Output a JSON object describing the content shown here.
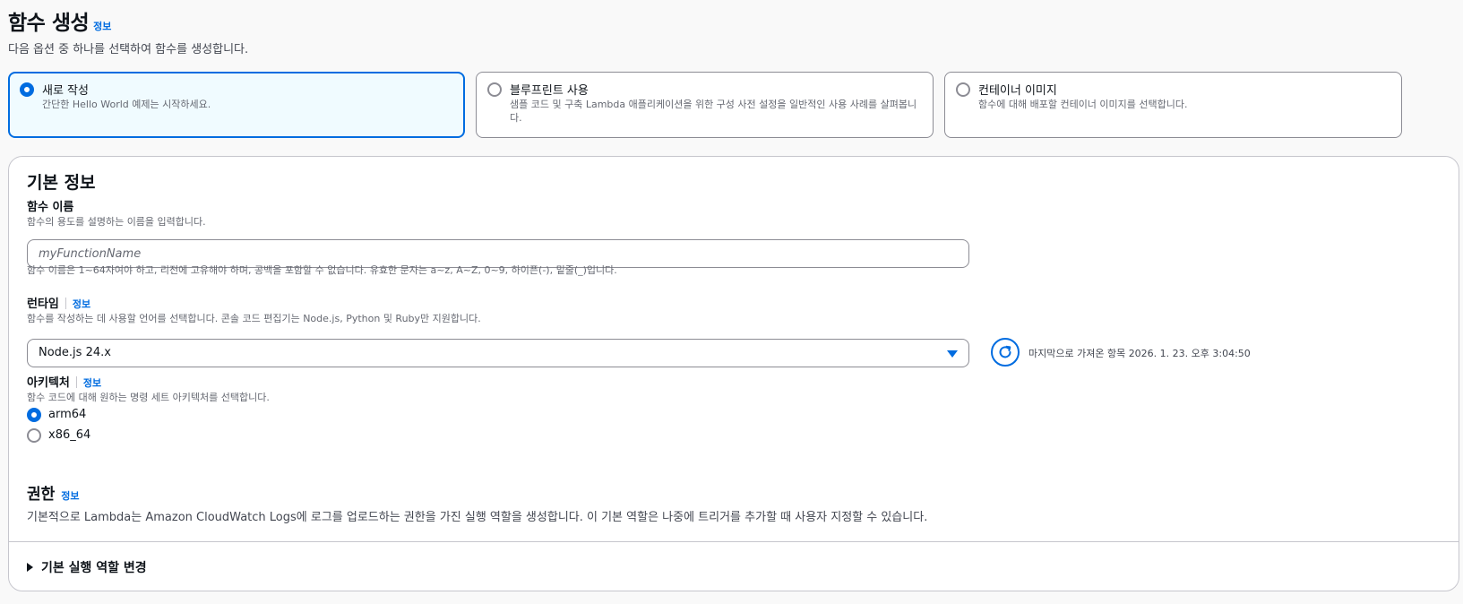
{
  "header": {
    "title": "함수 생성",
    "info": "정보",
    "description": "다음 옵션 중 하나를 선택하여 함수를 생성합니다."
  },
  "options": [
    {
      "label": "새로 작성",
      "description": "간단한 Hello World 예제는 시작하세요.",
      "selected": true
    },
    {
      "label": "블루프린트 사용",
      "description": "샘플 코드 및 구축 Lambda 애플리케이션을 위한 구성 사전 설정을 일반적인 사용 사례를 살펴봅니다.",
      "selected": false
    },
    {
      "label": "컨테이너 이미지",
      "description": "함수에 대해 배포할 컨테이너 이미지를 선택합니다.",
      "selected": false
    }
  ],
  "basic": {
    "title": "기본 정보",
    "function_name": {
      "label": "함수 이름",
      "description": "함수의 용도를 설명하는 이름을 입력합니다.",
      "placeholder": "myFunctionName",
      "value": "",
      "constraint": "함수 이름은 1~64자여야 하고, 리전에 고유해야 하며, 공백을 포함할 수 없습니다. 유효한 문자는 a~z, A~Z, 0~9, 하이픈(-), 밑줄(_)입니다."
    },
    "runtime": {
      "label": "런타임",
      "info": "정보",
      "description": "함수를 작성하는 데 사용할 언어를 선택합니다. 콘솔 코드 편집기는 Node.js, Python 및 Ruby만 지원합니다.",
      "selected": "Node.js 24.x",
      "last_fetched": "마지막으로 가져온 항목 2026. 1. 23. 오후 3:04:50"
    },
    "architecture": {
      "label": "아키텍처",
      "info": "정보",
      "description": "함수 코드에 대해 원하는 명령 세트 아키텍처를 선택합니다.",
      "options": [
        {
          "label": "arm64",
          "selected": true
        },
        {
          "label": "x86_64",
          "selected": false
        }
      ]
    },
    "permissions": {
      "title": "권한",
      "info": "정보",
      "description": "기본적으로 Lambda는 Amazon CloudWatch Logs에 로그를 업로드하는 권한을 가진 실행 역할을 생성합니다. 이 기본 역할은 나중에 트리거를 추가할 때 사용자 지정할 수 있습니다."
    },
    "change_role": "기본 실행 역할 변경"
  },
  "colors": {
    "accent": "#006ce0",
    "selected_bg": "#f0fbff",
    "text": "#0f141a",
    "muted": "#656871"
  }
}
